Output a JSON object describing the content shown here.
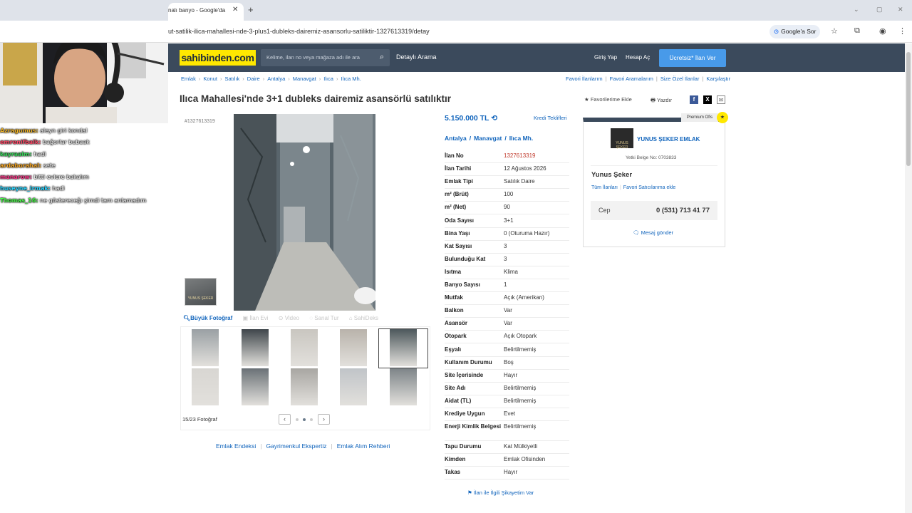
{
  "browser": {
    "tab_title": "nalı banyo - Google'da",
    "tab_close": "✕",
    "new_tab": "+",
    "url": "ut-satilik-ilica-mahallesi-nde-3-plus1-dubleks-dairemiz-asansorlu-satiliktir-1327613319/detay",
    "google_sor": "Google'a Sor"
  },
  "site": {
    "logo": "sahibinden.com",
    "search_placeholder": "Kelime, ilan no veya mağaza adı ile ara",
    "detayli_arama": "Detaylı Arama",
    "giris": "Giriş Yap",
    "hesap": "Hesap Aç",
    "ucretsiz": "Ücretsiz* İlan Ver",
    "brand_color": "#ffe800",
    "header_color": "#3b4a5c"
  },
  "breadcrumb": [
    "Emlak",
    "Konut",
    "Satılık",
    "Daire",
    "Antalya",
    "Manavgat",
    "Ilıca",
    "Ilıca Mh."
  ],
  "favlinks": [
    "Favori İlanlarım",
    "Favori Aramalarım",
    "Size Özel İlanlar",
    "Karşılaştır"
  ],
  "listing": {
    "title": "Ilıca Mahallesi'nde 3+1 dubleks dairemiz asansörlü satılıktır",
    "fav_add": "Favorilerime Ekle",
    "print": "Yazdır",
    "id_label": "#1327613319",
    "price": "5.150.000 TL",
    "kredi": "Kredi Teklifleri",
    "location": [
      "Antalya",
      "Manavgat",
      "Ilıca Mh."
    ],
    "details": [
      {
        "label": "İlan No",
        "value": "1327613319"
      },
      {
        "label": "İlan Tarihi",
        "value": "12 Ağustos 2026"
      },
      {
        "label": "Emlak Tipi",
        "value": "Satılık Daire"
      },
      {
        "label": "m² (Brüt)",
        "value": "100"
      },
      {
        "label": "m² (Net)",
        "value": "90"
      },
      {
        "label": "Oda Sayısı",
        "value": "3+1"
      },
      {
        "label": "Bina Yaşı",
        "value": "0 (Oturuma Hazır)"
      },
      {
        "label": "Kat Sayısı",
        "value": "3"
      },
      {
        "label": "Bulunduğu Kat",
        "value": "3"
      },
      {
        "label": "Isıtma",
        "value": "Klima"
      },
      {
        "label": "Banyo Sayısı",
        "value": "1"
      },
      {
        "label": "Mutfak",
        "value": "Açık (Amerikan)"
      },
      {
        "label": "Balkon",
        "value": "Var"
      },
      {
        "label": "Asansör",
        "value": "Var"
      },
      {
        "label": "Otopark",
        "value": "Açık Otopark"
      },
      {
        "label": "Eşyalı",
        "value": "Belirtilmemiş"
      },
      {
        "label": "Kullanım Durumu",
        "value": "Boş"
      },
      {
        "label": "Site İçerisinde",
        "value": "Hayır"
      },
      {
        "label": "Site Adı",
        "value": "Belirtilmemiş"
      },
      {
        "label": "Aidat (TL)",
        "value": "Belirtilmemiş"
      },
      {
        "label": "Krediye Uygun",
        "value": "Evet"
      },
      {
        "label": "Enerji Kimlik Belgesi",
        "value": "Belirtilmemiş"
      },
      {
        "label": "Tapu Durumu",
        "value": "Kat Mülkiyetli"
      },
      {
        "label": "Kimden",
        "value": "Emlak Ofisinden"
      },
      {
        "label": "Takas",
        "value": "Hayır"
      }
    ],
    "sikayet": "İlan ile İlgili Şikayetim Var"
  },
  "gallery": {
    "buyuk": "Büyük Fotoğraf",
    "ilan_evi": "İlan Evi",
    "video": "Video",
    "sanal_tur": "Sanal Tur",
    "sahideks": "SahiDeks",
    "count": "15/23 Fotoğraf",
    "prev": "‹",
    "next": "›"
  },
  "footer_links": [
    "Emlak Endeksi",
    "Gayrimenkul Ekspertiz",
    "Emlak Alım Rehberi"
  ],
  "agent": {
    "premium": "Premium Ofis",
    "logo_text": "YUNUS ŞEKER",
    "name": "YUNUS ŞEKER EMLAK",
    "yetki": "Yetki Belge No:  0703833",
    "person": "Yunus Şeker",
    "tum": "Tüm İlanları",
    "fav_satici": "Favori Satıcılarıma ekle",
    "cep_label": "Cep",
    "cep_number": "0 (531) 713 41 77",
    "mesaj": "Mesaj gönder"
  },
  "chat": [
    {
      "user": "Azragumus:",
      "color": "#f0b429",
      "text": "aleyn giri kondal"
    },
    {
      "user": "emrenifbalk:",
      "color": "#ff4d6a",
      "text": "bağorlar bubaak"
    },
    {
      "user": "kayraalm:",
      "color": "#39d65b",
      "text": "hadi"
    },
    {
      "user": "ardaborahal:",
      "color": "#f6a623",
      "text": "sete"
    },
    {
      "user": "manarow:",
      "color": "#ff3b8c",
      "text": "bitti evlere bakalım"
    },
    {
      "user": "huseyne_irmak:",
      "color": "#2ad4ff",
      "text": "hadi"
    },
    {
      "user": "Thomas_16:",
      "color": "#4cff4c",
      "text": "ne göstereceğı şimdi tam anlamadım"
    }
  ]
}
